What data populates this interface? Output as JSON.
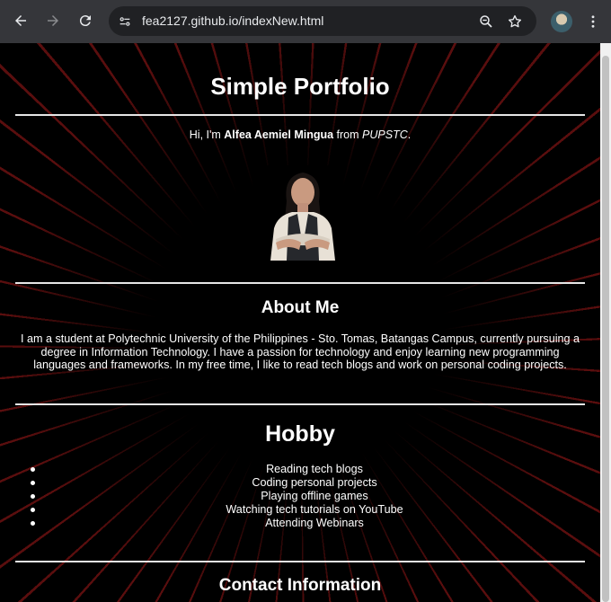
{
  "browser": {
    "url": "fea2127.github.io/indexNew.html",
    "icons": {
      "back": "arrow-left-icon",
      "forward": "arrow-right-icon",
      "reload": "reload-icon",
      "site_info": "tune-icon",
      "zoom": "zoom-out-icon",
      "bookmark": "star-icon",
      "profile": "avatar",
      "menu": "kebab-menu-icon"
    }
  },
  "page": {
    "title": "Simple Portfolio",
    "intro": {
      "prefix": "Hi, I'm ",
      "name": "Alfea Aemiel Mingua",
      "middle": " from ",
      "school": "PUPSTC",
      "suffix": "."
    },
    "about": {
      "heading": "About Me",
      "text": "I am a student at Polytechnic University of the Philippines - Sto. Tomas, Batangas Campus, currently pursuing a degree in Information Technology. I have a passion for technology and enjoy learning new programming languages and frameworks. In my free time, I like to read tech blogs and work on personal coding projects."
    },
    "hobby": {
      "heading": "Hobby",
      "items": [
        "Reading tech blogs",
        "Coding personal projects",
        "Playing offline games",
        "Watching tech tutorials on YouTube",
        "Attending Webinars"
      ]
    },
    "contact": {
      "heading": "Contact Information"
    }
  },
  "colors": {
    "chrome_bg": "#35363a",
    "omnibox_bg": "#202124",
    "page_bg": "#000000",
    "accent_dots": "#c81e1e"
  }
}
